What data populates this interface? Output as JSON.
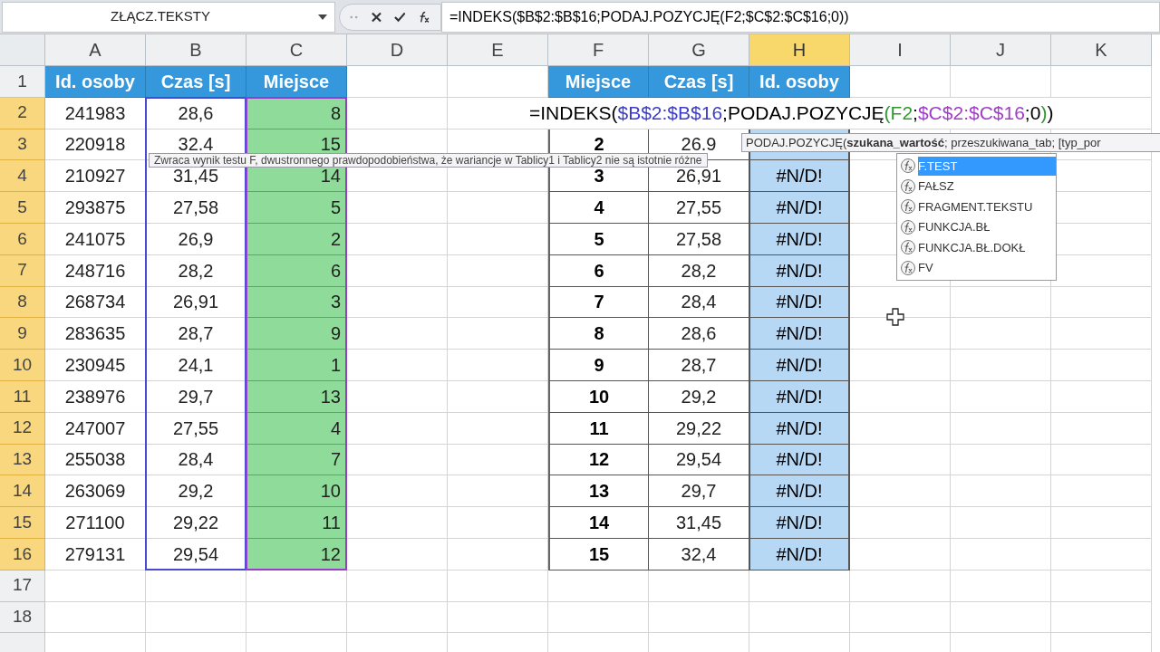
{
  "formula_bar": {
    "name_box": "ZŁĄCZ.TEKSTY",
    "formula": "=INDEKS($B$2:$B$16;PODAJ.POZYCJĘ(F2;$C$2:$C$16;0))"
  },
  "columns": [
    {
      "label": "A",
      "highlighted": false
    },
    {
      "label": "B",
      "highlighted": false
    },
    {
      "label": "C",
      "highlighted": false
    },
    {
      "label": "D",
      "highlighted": false
    },
    {
      "label": "E",
      "highlighted": false
    },
    {
      "label": "F",
      "highlighted": false
    },
    {
      "label": "G",
      "highlighted": false
    },
    {
      "label": "H",
      "highlighted": true
    },
    {
      "label": "I",
      "highlighted": false
    },
    {
      "label": "J",
      "highlighted": false
    },
    {
      "label": "K",
      "highlighted": false
    }
  ],
  "rows": [
    {
      "number": "1",
      "highlighted": false,
      "cells": {
        "A": {
          "text": "Id. osoby",
          "kind": "header"
        },
        "B": {
          "text": "Czas [s]",
          "kind": "header"
        },
        "C": {
          "text": "Miejsce",
          "kind": "header"
        },
        "F": {
          "text": "Miejsce",
          "kind": "header"
        },
        "G": {
          "text": "Czas [s]",
          "kind": "header"
        },
        "H": {
          "text": "Id. osoby",
          "kind": "header"
        }
      }
    },
    {
      "number": "2",
      "highlighted": true,
      "cells": {
        "A": {
          "text": "241983",
          "kind": "plain"
        },
        "B": {
          "text": "28,6",
          "kind": "plain"
        },
        "C": {
          "text": "8",
          "kind": "place"
        }
      }
    },
    {
      "number": "3",
      "highlighted": true,
      "cells": {
        "A": {
          "text": "220918",
          "kind": "plain"
        },
        "B": {
          "text": "32.4",
          "kind": "plain"
        },
        "C": {
          "text": "15",
          "kind": "place"
        },
        "F": {
          "text": "2",
          "kind": "rank"
        },
        "G": {
          "text": "26.9",
          "kind": "time"
        },
        "H": {
          "kind": "result"
        }
      }
    },
    {
      "number": "4",
      "highlighted": true,
      "cells": {
        "A": {
          "text": "210927",
          "kind": "plain"
        },
        "B": {
          "text": "31,45",
          "kind": "plain"
        },
        "C": {
          "text": "14",
          "kind": "place"
        },
        "F": {
          "text": "3",
          "kind": "rank"
        },
        "G": {
          "text": "26,91",
          "kind": "time"
        },
        "H": {
          "text": "#N/D!",
          "kind": "result"
        }
      }
    },
    {
      "number": "5",
      "highlighted": true,
      "cells": {
        "A": {
          "text": "293875",
          "kind": "plain"
        },
        "B": {
          "text": "27,58",
          "kind": "plain"
        },
        "C": {
          "text": "5",
          "kind": "place"
        },
        "F": {
          "text": "4",
          "kind": "rank"
        },
        "G": {
          "text": "27,55",
          "kind": "time"
        },
        "H": {
          "text": "#N/D!",
          "kind": "result"
        }
      }
    },
    {
      "number": "6",
      "highlighted": true,
      "cells": {
        "A": {
          "text": "241075",
          "kind": "plain"
        },
        "B": {
          "text": "26,9",
          "kind": "plain"
        },
        "C": {
          "text": "2",
          "kind": "place"
        },
        "F": {
          "text": "5",
          "kind": "rank"
        },
        "G": {
          "text": "27,58",
          "kind": "time"
        },
        "H": {
          "text": "#N/D!",
          "kind": "result"
        }
      }
    },
    {
      "number": "7",
      "highlighted": true,
      "cells": {
        "A": {
          "text": "248716",
          "kind": "plain"
        },
        "B": {
          "text": "28,2",
          "kind": "plain"
        },
        "C": {
          "text": "6",
          "kind": "place"
        },
        "F": {
          "text": "6",
          "kind": "rank"
        },
        "G": {
          "text": "28,2",
          "kind": "time"
        },
        "H": {
          "text": "#N/D!",
          "kind": "result"
        }
      }
    },
    {
      "number": "8",
      "highlighted": true,
      "cells": {
        "A": {
          "text": "268734",
          "kind": "plain"
        },
        "B": {
          "text": "26,91",
          "kind": "plain"
        },
        "C": {
          "text": "3",
          "kind": "place"
        },
        "F": {
          "text": "7",
          "kind": "rank"
        },
        "G": {
          "text": "28,4",
          "kind": "time"
        },
        "H": {
          "text": "#N/D!",
          "kind": "result"
        }
      }
    },
    {
      "number": "9",
      "highlighted": true,
      "cells": {
        "A": {
          "text": "283635",
          "kind": "plain"
        },
        "B": {
          "text": "28,7",
          "kind": "plain"
        },
        "C": {
          "text": "9",
          "kind": "place"
        },
        "F": {
          "text": "8",
          "kind": "rank"
        },
        "G": {
          "text": "28,6",
          "kind": "time"
        },
        "H": {
          "text": "#N/D!",
          "kind": "result"
        }
      }
    },
    {
      "number": "10",
      "highlighted": true,
      "cells": {
        "A": {
          "text": "230945",
          "kind": "plain"
        },
        "B": {
          "text": "24,1",
          "kind": "plain"
        },
        "C": {
          "text": "1",
          "kind": "place"
        },
        "F": {
          "text": "9",
          "kind": "rank"
        },
        "G": {
          "text": "28,7",
          "kind": "time"
        },
        "H": {
          "text": "#N/D!",
          "kind": "result"
        }
      }
    },
    {
      "number": "11",
      "highlighted": true,
      "cells": {
        "A": {
          "text": "238976",
          "kind": "plain"
        },
        "B": {
          "text": "29,7",
          "kind": "plain"
        },
        "C": {
          "text": "13",
          "kind": "place"
        },
        "F": {
          "text": "10",
          "kind": "rank"
        },
        "G": {
          "text": "29,2",
          "kind": "time"
        },
        "H": {
          "text": "#N/D!",
          "kind": "result"
        }
      }
    },
    {
      "number": "12",
      "highlighted": true,
      "cells": {
        "A": {
          "text": "247007",
          "kind": "plain"
        },
        "B": {
          "text": "27,55",
          "kind": "plain"
        },
        "C": {
          "text": "4",
          "kind": "place"
        },
        "F": {
          "text": "11",
          "kind": "rank"
        },
        "G": {
          "text": "29,22",
          "kind": "time"
        },
        "H": {
          "text": "#N/D!",
          "kind": "result"
        }
      }
    },
    {
      "number": "13",
      "highlighted": true,
      "cells": {
        "A": {
          "text": "255038",
          "kind": "plain"
        },
        "B": {
          "text": "28,4",
          "kind": "plain"
        },
        "C": {
          "text": "7",
          "kind": "place"
        },
        "F": {
          "text": "12",
          "kind": "rank"
        },
        "G": {
          "text": "29,54",
          "kind": "time"
        },
        "H": {
          "text": "#N/D!",
          "kind": "result"
        }
      }
    },
    {
      "number": "14",
      "highlighted": true,
      "cells": {
        "A": {
          "text": "263069",
          "kind": "plain"
        },
        "B": {
          "text": "29,2",
          "kind": "plain"
        },
        "C": {
          "text": "10",
          "kind": "place"
        },
        "F": {
          "text": "13",
          "kind": "rank"
        },
        "G": {
          "text": "29,7",
          "kind": "time"
        },
        "H": {
          "text": "#N/D!",
          "kind": "result"
        }
      }
    },
    {
      "number": "15",
      "highlighted": true,
      "cells": {
        "A": {
          "text": "271100",
          "kind": "plain"
        },
        "B": {
          "text": "29,22",
          "kind": "plain"
        },
        "C": {
          "text": "11",
          "kind": "place"
        },
        "F": {
          "text": "14",
          "kind": "rank"
        },
        "G": {
          "text": "31,45",
          "kind": "time"
        },
        "H": {
          "text": "#N/D!",
          "kind": "result"
        }
      }
    },
    {
      "number": "16",
      "highlighted": true,
      "cells": {
        "A": {
          "text": "279131",
          "kind": "plain"
        },
        "B": {
          "text": "29,54",
          "kind": "plain"
        },
        "C": {
          "text": "12",
          "kind": "place"
        },
        "F": {
          "text": "15",
          "kind": "rank"
        },
        "G": {
          "text": "32,4",
          "kind": "time"
        },
        "H": {
          "text": "#N/D!",
          "kind": "result"
        }
      }
    },
    {
      "number": "17",
      "highlighted": false,
      "cells": {}
    },
    {
      "number": "18",
      "highlighted": false,
      "cells": {}
    },
    {
      "highlighted": false,
      "cells": {}
    }
  ],
  "cell_editor": {
    "segments": [
      {
        "text": "=INDEKS(",
        "color": "#000000"
      },
      {
        "text": "$B$2:$B$16",
        "color": "#3c3cc8"
      },
      {
        "text": ";PODAJ.POZYCJĘ",
        "color": "#000000"
      },
      {
        "text": "(F2",
        "color": "#2e9a2e"
      },
      {
        "text": ";",
        "color": "#000000"
      },
      {
        "text": "$C$2:$C$16",
        "color": "#a03cc8"
      },
      {
        "text": ";0",
        "color": "#000000"
      },
      {
        "text": ")",
        "color": "#2e9a2e"
      },
      {
        "text": ")",
        "color": "#000000"
      }
    ]
  },
  "function_tooltip": "PODAJ.POZYCJĘ(**szukana_wartość**; przeszukiwana_tab; [typ_por",
  "description_tooltip": "Zwraca wynik testu F, dwustronnego prawdopodobieństwa, że wariancje w Tablicy1 i Tablicy2 nie są istotnie różne",
  "autocomplete": [
    {
      "label": "F.TEST",
      "selected": true
    },
    {
      "label": "FAŁSZ",
      "selected": false
    },
    {
      "label": "FRAGMENT.TEKSTU",
      "selected": false
    },
    {
      "label": "FUNKCJA.BŁ",
      "selected": false
    },
    {
      "label": "FUNKCJA.BŁ.DOKŁ",
      "selected": false
    },
    {
      "label": "FV",
      "selected": false
    }
  ]
}
